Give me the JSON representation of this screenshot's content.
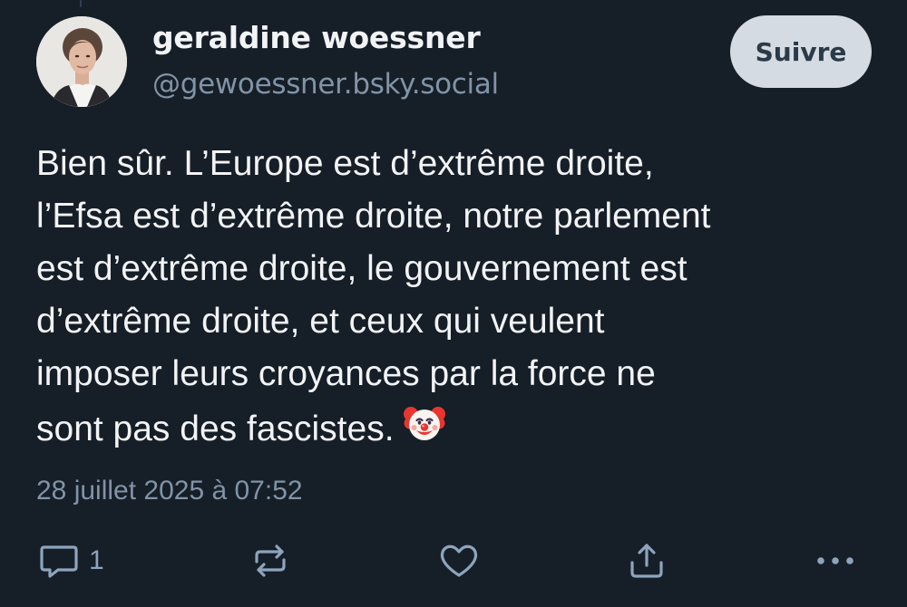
{
  "author": {
    "display_name": "geraldine woessner",
    "handle": "@gewoessner.bsky.social"
  },
  "follow_button": {
    "label": "Suivre"
  },
  "post": {
    "lines": [
      "Bien sûr. L’Europe est d’extrême droite,",
      "l’Efsa est d’extrême droite, notre parlement",
      "est d’extrême droite, le gouvernement est",
      "d’extrême droite, et ceux qui veulent",
      "imposer leurs croyances par la force ne",
      "sont pas des fascistes."
    ],
    "emoji": "clown-face",
    "timestamp": "28 juillet 2025 à 07:52"
  },
  "actions": {
    "reply_count": "1",
    "icons": [
      "reply-icon",
      "repost-icon",
      "like-icon",
      "share-icon",
      "more-icon"
    ]
  },
  "colors": {
    "background": "#161e27",
    "text": "#f1f3f5",
    "muted": "#8193a7",
    "icon": "#8da4bd",
    "follow_button_bg": "#d4dbe2",
    "follow_button_text": "#2b3a48"
  }
}
